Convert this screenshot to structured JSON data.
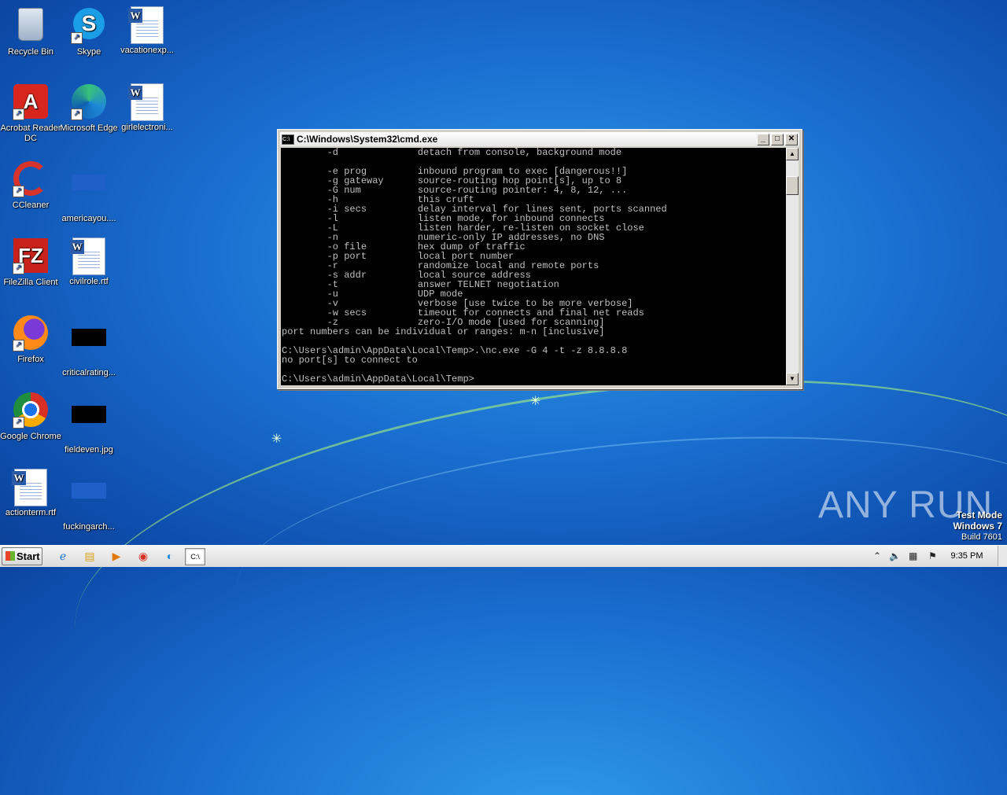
{
  "desktop": {
    "icons": [
      {
        "label": "Recycle Bin",
        "icon": "recycle-bin-icon"
      },
      {
        "label": "Skype",
        "icon": "skype-icon"
      },
      {
        "label": "vacationexp...",
        "icon": "word-document-icon"
      },
      {
        "label": "Acrobat Reader DC",
        "icon": "acrobat-icon"
      },
      {
        "label": "Microsoft Edge",
        "icon": "edge-icon"
      },
      {
        "label": "girlelectroni...",
        "icon": "word-document-icon"
      },
      {
        "label": "CCleaner",
        "icon": "ccleaner-icon"
      },
      {
        "label": "americayou....",
        "icon": "blank-file-icon"
      },
      {
        "label": "FileZilla Client",
        "icon": "filezilla-icon"
      },
      {
        "label": "civilrole.rtf",
        "icon": "word-document-icon"
      },
      {
        "label": "Firefox",
        "icon": "firefox-icon"
      },
      {
        "label": "criticalrating...",
        "icon": "black-image-icon"
      },
      {
        "label": "Google Chrome",
        "icon": "chrome-icon"
      },
      {
        "label": "fieldeven.jpg",
        "icon": "black-image-icon"
      },
      {
        "label": "actionterm.rtf",
        "icon": "word-document-icon"
      },
      {
        "label": "fuckingarch...",
        "icon": "blank-file-icon"
      }
    ]
  },
  "cmd": {
    "title": "C:\\Windows\\System32\\cmd.exe",
    "lines": [
      "        -d              detach from console, background mode",
      "",
      "        -e prog         inbound program to exec [dangerous!!]",
      "        -g gateway      source-routing hop point[s], up to 8",
      "        -G num          source-routing pointer: 4, 8, 12, ...",
      "        -h              this cruft",
      "        -i secs         delay interval for lines sent, ports scanned",
      "        -l              listen mode, for inbound connects",
      "        -L              listen harder, re-listen on socket close",
      "        -n              numeric-only IP addresses, no DNS",
      "        -o file         hex dump of traffic",
      "        -p port         local port number",
      "        -r              randomize local and remote ports",
      "        -s addr         local source address",
      "        -t              answer TELNET negotiation",
      "        -u              UDP mode",
      "        -v              verbose [use twice to be more verbose]",
      "        -w secs         timeout for connects and final net reads",
      "        -z              zero-I/O mode [used for scanning]",
      "port numbers can be individual or ranges: m-n [inclusive]",
      "",
      "C:\\Users\\admin\\AppData\\Local\\Temp>.\\nc.exe -G 4 -t -z 8.8.8.8",
      "no port[s] to connect to",
      "",
      "C:\\Users\\admin\\AppData\\Local\\Temp>"
    ]
  },
  "watermark": {
    "text": "ANY RUN"
  },
  "testmode": {
    "line1": "Test Mode",
    "line2": "Windows 7",
    "line3": "Build 7601"
  },
  "taskbar": {
    "start_label": "Start",
    "clock": "9:35 PM"
  }
}
